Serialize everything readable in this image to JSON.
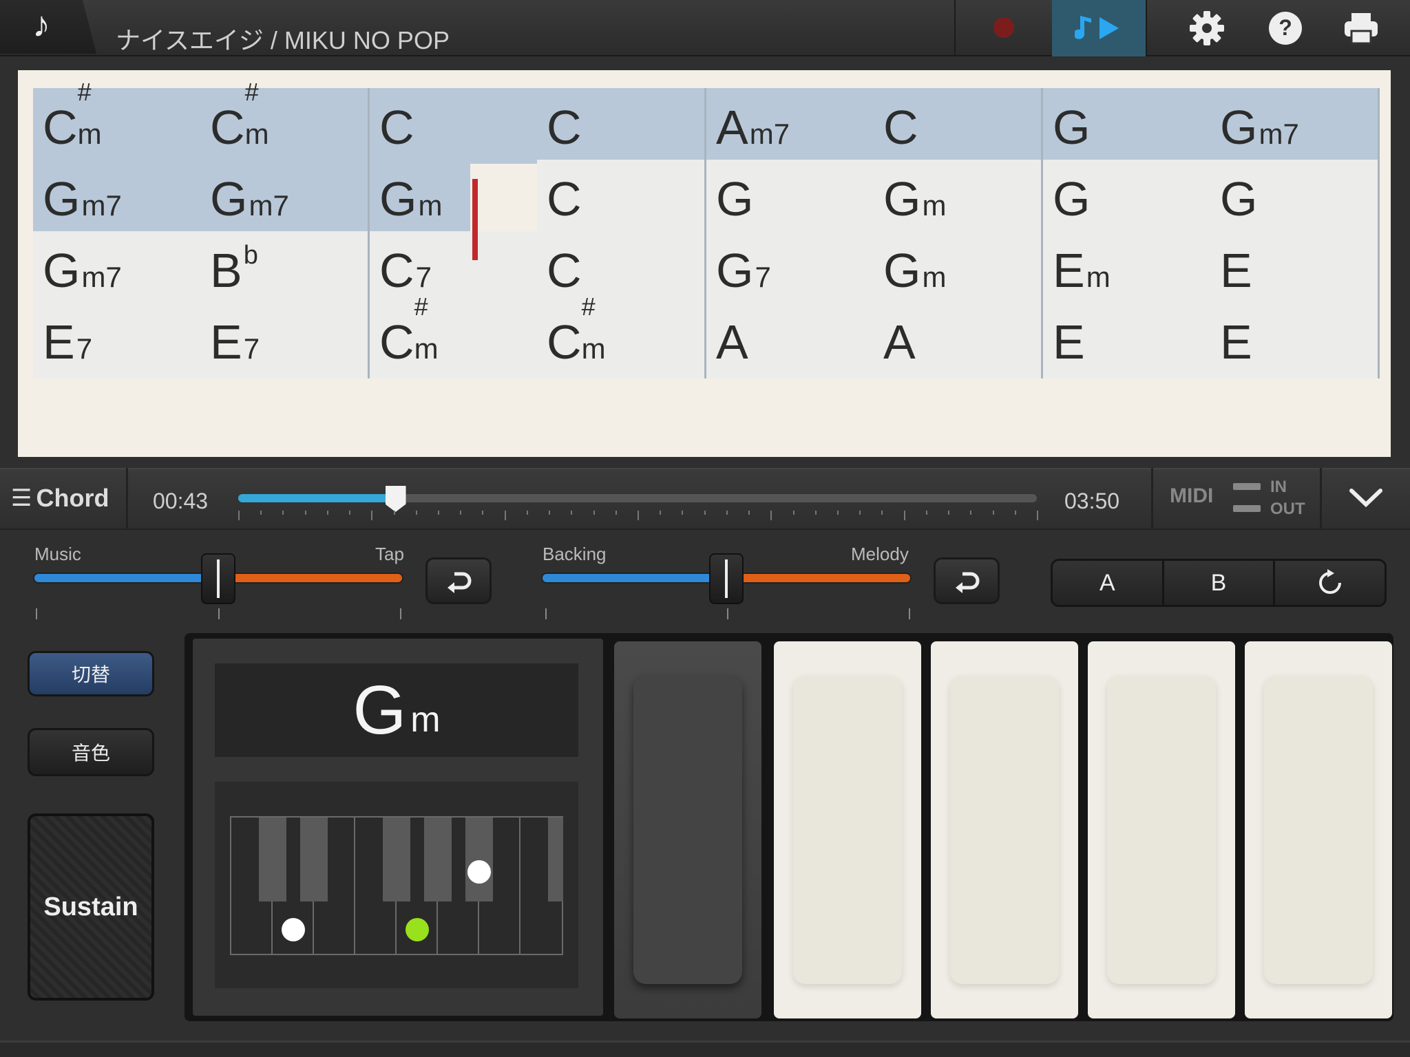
{
  "header": {
    "home_icon_glyph": "♪",
    "title": "ナイスエイジ / MIKU NO POP",
    "record_icon": "record-icon",
    "play_icon": "play-mode-icon",
    "settings_icon": "gear-icon",
    "help_icon": "help-icon",
    "print_icon": "printer-icon",
    "play_color": "#2aa7f0",
    "record_color": "#7c1d1d"
  },
  "chord_sheet": {
    "rows": [
      {
        "played": 8,
        "chords": [
          {
            "root": "C",
            "acc": "#",
            "suf": "m"
          },
          {
            "root": "C",
            "acc": "#",
            "suf": "m"
          },
          {
            "root": "C",
            "acc": "",
            "suf": ""
          },
          {
            "root": "C",
            "acc": "",
            "suf": ""
          },
          {
            "root": "A",
            "acc": "",
            "suf": "m7"
          },
          {
            "root": "C",
            "acc": "",
            "suf": ""
          },
          {
            "root": "G",
            "acc": "",
            "suf": ""
          },
          {
            "root": "G",
            "acc": "",
            "suf": "m7"
          }
        ]
      },
      {
        "played": 3,
        "chords": [
          {
            "root": "G",
            "acc": "",
            "suf": "m7"
          },
          {
            "root": "G",
            "acc": "",
            "suf": "m7"
          },
          {
            "root": "G",
            "acc": "",
            "suf": "m"
          },
          {
            "root": "C",
            "acc": "",
            "suf": ""
          },
          {
            "root": "G",
            "acc": "",
            "suf": ""
          },
          {
            "root": "G",
            "acc": "",
            "suf": "m"
          },
          {
            "root": "G",
            "acc": "",
            "suf": ""
          },
          {
            "root": "G",
            "acc": "",
            "suf": ""
          }
        ]
      },
      {
        "played": 0,
        "chords": [
          {
            "root": "G",
            "acc": "",
            "suf": "m7"
          },
          {
            "root": "B",
            "acc": "b",
            "suf": ""
          },
          {
            "root": "C",
            "acc": "",
            "suf": "7"
          },
          {
            "root": "C",
            "acc": "",
            "suf": ""
          },
          {
            "root": "G",
            "acc": "",
            "suf": "7"
          },
          {
            "root": "G",
            "acc": "",
            "suf": "m"
          },
          {
            "root": "E",
            "acc": "",
            "suf": "m"
          },
          {
            "root": "E",
            "acc": "",
            "suf": ""
          }
        ]
      },
      {
        "played": 0,
        "chords": [
          {
            "root": "E",
            "acc": "",
            "suf": "7"
          },
          {
            "root": "E",
            "acc": "",
            "suf": "7"
          },
          {
            "root": "C",
            "acc": "#",
            "suf": "m"
          },
          {
            "root": "C",
            "acc": "#",
            "suf": "m"
          },
          {
            "root": "A",
            "acc": "",
            "suf": ""
          },
          {
            "root": "A",
            "acc": "",
            "suf": ""
          },
          {
            "root": "E",
            "acc": "",
            "suf": ""
          },
          {
            "root": "E",
            "acc": "",
            "suf": ""
          }
        ]
      }
    ],
    "played_color": "#b8c8d8",
    "unplayed_color": "#ececeb",
    "cursor_color": "#c0282c"
  },
  "transport": {
    "menu_label": "Chord",
    "current_time": "00:43",
    "total_time": "03:50",
    "progress": 0.197,
    "midi_label": "MIDI",
    "midi_in": "IN",
    "midi_out": "OUT"
  },
  "mixers": {
    "music_label": "Music",
    "tap_label": "Tap",
    "music_balance": 0.5,
    "backing_label": "Backing",
    "melody_label": "Melody",
    "backing_balance": 0.5
  },
  "sections": {
    "a_label": "A",
    "b_label": "B",
    "repeat_icon": "repeat-icon"
  },
  "left_buttons": {
    "switch_label": "切替",
    "tone_label": "音色",
    "sustain_label": "Sustain"
  },
  "current_chord": {
    "root": "G",
    "suffix": "m"
  }
}
